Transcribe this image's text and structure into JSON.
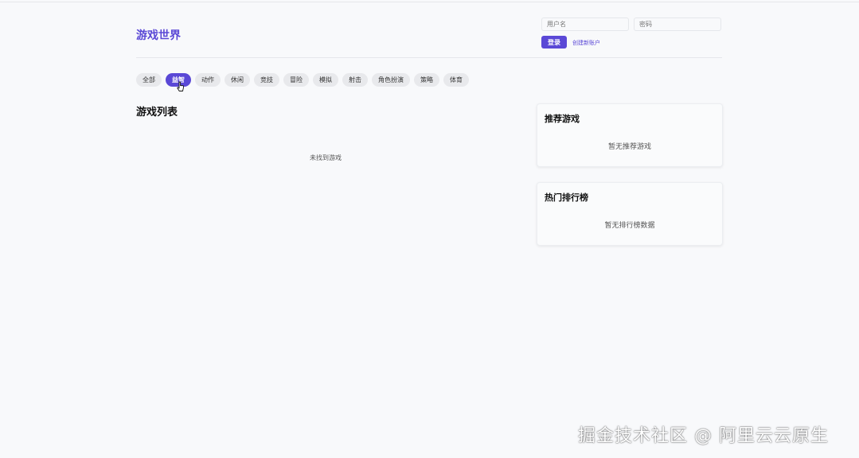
{
  "header": {
    "brand": "游戏世界",
    "username_placeholder": "用户名",
    "password_placeholder": "密码",
    "login_label": "登录",
    "register_label": "创建新账户"
  },
  "filters": [
    {
      "label": "全部",
      "active": false
    },
    {
      "label": "益智",
      "active": true
    },
    {
      "label": "动作",
      "active": false
    },
    {
      "label": "休闲",
      "active": false
    },
    {
      "label": "竞技",
      "active": false
    },
    {
      "label": "冒险",
      "active": false
    },
    {
      "label": "模拟",
      "active": false
    },
    {
      "label": "射击",
      "active": false
    },
    {
      "label": "角色扮演",
      "active": false
    },
    {
      "label": "策略",
      "active": false
    },
    {
      "label": "体育",
      "active": false
    }
  ],
  "main": {
    "title": "游戏列表",
    "empty_text": "未找到游戏"
  },
  "sidebar": {
    "recommended": {
      "title": "推荐游戏",
      "empty_text": "暂无推荐游戏"
    },
    "ranking": {
      "title": "热门排行榜",
      "empty_text": "暂无排行榜数据"
    }
  },
  "watermark": "掘金技术社区 @ 阿里云云原生",
  "colors": {
    "accent": "#5a48d6",
    "background": "#f8f9fb",
    "chip": "#e8e9ec"
  }
}
